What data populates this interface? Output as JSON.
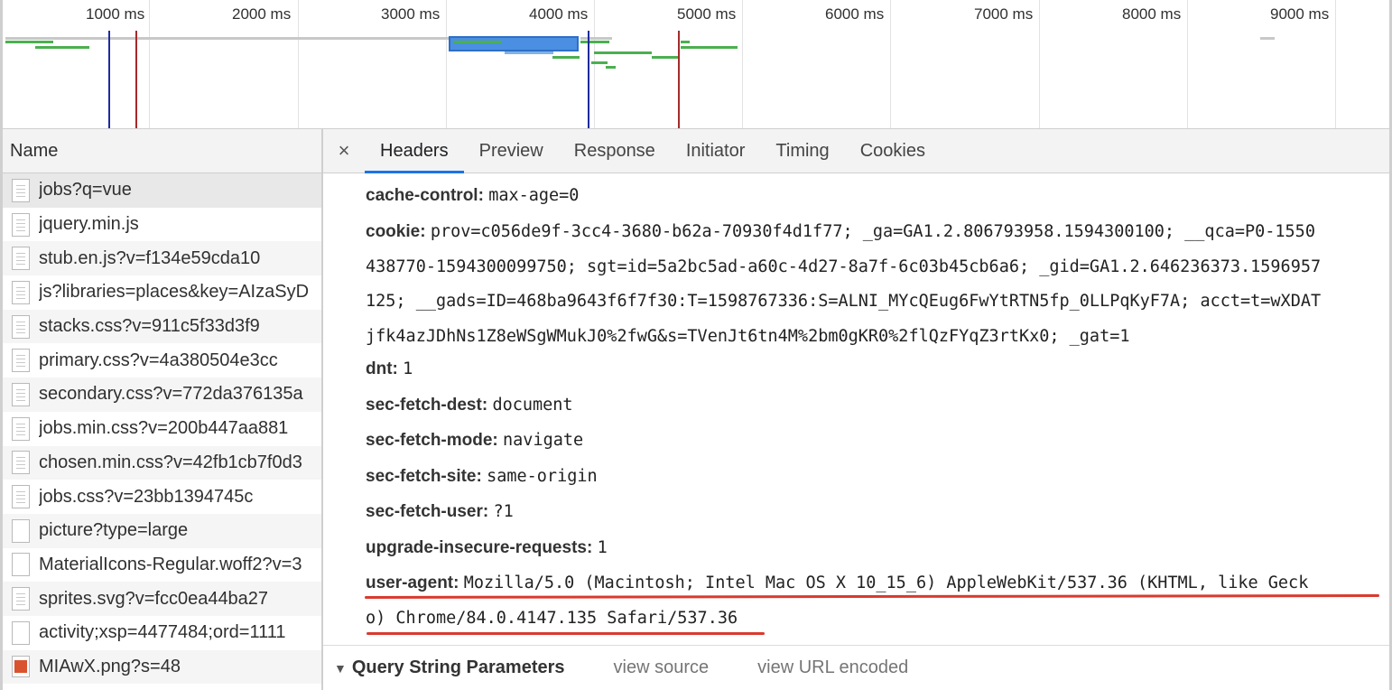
{
  "timeline": {
    "ticks": [
      "1000 ms",
      "2000 ms",
      "3000 ms",
      "4000 ms",
      "5000 ms",
      "6000 ms",
      "7000 ms",
      "8000 ms",
      "9000 ms"
    ]
  },
  "requests": {
    "column_header": "Name",
    "items": [
      {
        "name": "jobs?q=vue",
        "icon": "document-icon"
      },
      {
        "name": "jquery.min.js",
        "icon": "document-icon"
      },
      {
        "name": "stub.en.js?v=f134e59cda10",
        "icon": "document-icon"
      },
      {
        "name": "js?libraries=places&key=AIzaSyD",
        "icon": "document-icon"
      },
      {
        "name": "stacks.css?v=911c5f33d3f9",
        "icon": "document-icon"
      },
      {
        "name": "primary.css?v=4a380504e3cc",
        "icon": "document-icon"
      },
      {
        "name": "secondary.css?v=772da376135a",
        "icon": "document-icon"
      },
      {
        "name": "jobs.min.css?v=200b447aa881",
        "icon": "document-icon"
      },
      {
        "name": "chosen.min.css?v=42fb1cb7f0d3",
        "icon": "document-icon"
      },
      {
        "name": "jobs.css?v=23bb1394745c",
        "icon": "document-icon"
      },
      {
        "name": "picture?type=large",
        "icon": "blank-file-icon"
      },
      {
        "name": "MaterialIcons-Regular.woff2?v=3",
        "icon": "blank-file-icon"
      },
      {
        "name": "sprites.svg?v=fcc0ea44ba27",
        "icon": "document-icon"
      },
      {
        "name": "activity;xsp=4477484;ord=1111",
        "icon": "blank-file-icon"
      },
      {
        "name": "MIAwX.png?s=48",
        "icon": "image-icon"
      }
    ]
  },
  "tabs": {
    "close": "×",
    "items": [
      "Headers",
      "Preview",
      "Response",
      "Initiator",
      "Timing",
      "Cookies"
    ],
    "active": "Headers"
  },
  "headers": {
    "cache_control": {
      "key": "cache-control:",
      "value": "max-age=0"
    },
    "cookie": {
      "key": "cookie:",
      "line1": "prov=c056de9f-3cc4-3680-b62a-70930f4d1f77; _ga=GA1.2.806793958.1594300100; __qca=P0-1550",
      "line2": "438770-1594300099750; sgt=id=5a2bc5ad-a60c-4d27-8a7f-6c03b45cb6a6; _gid=GA1.2.646236373.1596957",
      "line3": "125; __gads=ID=468ba9643f6f7f30:T=1598767336:S=ALNI_MYcQEug6FwYtRTN5fp_0LLPqKyF7A; acct=t=wXDAT",
      "line4": "jfk4azJDhNs1Z8eWSgWMukJ0%2fwG&s=TVenJt6tn4M%2bm0gKR0%2flQzFYqZ3rtKx0; _gat=1"
    },
    "dnt": {
      "key": "dnt:",
      "value": "1"
    },
    "sec_fetch_dest": {
      "key": "sec-fetch-dest:",
      "value": "document"
    },
    "sec_fetch_mode": {
      "key": "sec-fetch-mode:",
      "value": "navigate"
    },
    "sec_fetch_site": {
      "key": "sec-fetch-site:",
      "value": "same-origin"
    },
    "sec_fetch_user": {
      "key": "sec-fetch-user:",
      "value": "?1"
    },
    "upgrade_insecure_requests": {
      "key": "upgrade-insecure-requests:",
      "value": "1"
    },
    "user_agent": {
      "key": "user-agent:",
      "line1": "Mozilla/5.0 (Macintosh; Intel Mac OS X 10_15_6) AppleWebKit/537.36 (KHTML, like Geck",
      "line2": "o) Chrome/84.0.4147.135 Safari/537.36"
    }
  },
  "query_string": {
    "toggle": "▼",
    "title": "Query String Parameters",
    "view_source": "view source",
    "view_url_encoded": "view URL encoded"
  },
  "colors": {
    "accent": "#1a73e8",
    "highlight_underline": "#d93a2e",
    "bar_green": "#4caf50",
    "dom_content_loaded": "#1f2a9e",
    "load_event": "#a52a2a"
  }
}
